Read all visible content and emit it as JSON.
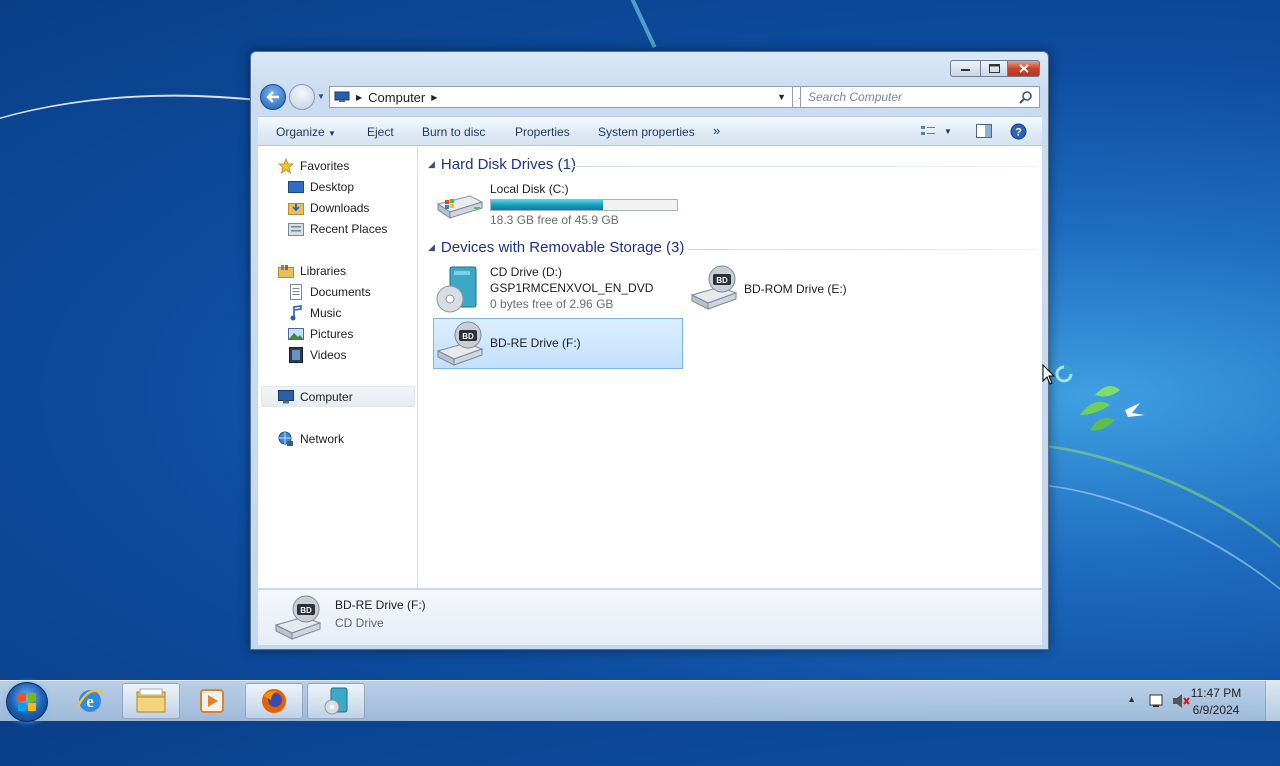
{
  "window": {
    "address_segment": "Computer",
    "search_placeholder": "Search Computer"
  },
  "toolbar": {
    "organize": "Organize",
    "eject": "Eject",
    "burn": "Burn to disc",
    "properties": "Properties",
    "system_properties": "System properties",
    "more": "»"
  },
  "nav": {
    "favorites": "Favorites",
    "desktop": "Desktop",
    "downloads": "Downloads",
    "recent": "Recent Places",
    "libraries": "Libraries",
    "documents": "Documents",
    "music": "Music",
    "pictures": "Pictures",
    "videos": "Videos",
    "computer": "Computer",
    "network": "Network"
  },
  "groups": {
    "hdd": "Hard Disk Drives (1)",
    "removable": "Devices with Removable Storage (3)"
  },
  "drives": {
    "c": {
      "name": "Local Disk (C:)",
      "free": "18.3 GB free of 45.9 GB",
      "used_fraction": 0.6
    },
    "d": {
      "name": "CD Drive (D:)",
      "label": "GSP1RMCENXVOL_EN_DVD",
      "free": "0 bytes free of 2.96 GB"
    },
    "e": {
      "name": "BD-ROM Drive (E:)"
    },
    "f": {
      "name": "BD-RE Drive (F:)"
    }
  },
  "details": {
    "name": "BD-RE Drive (F:)",
    "type": "CD Drive"
  },
  "taskbar": {
    "time": "11:47 PM",
    "date": "6/9/2024"
  },
  "icons": {
    "bd_badge": "BD"
  },
  "colors": {
    "selection": "#cce4fb",
    "group_header": "#1e3287",
    "capacity_bar": "#1797b8"
  }
}
